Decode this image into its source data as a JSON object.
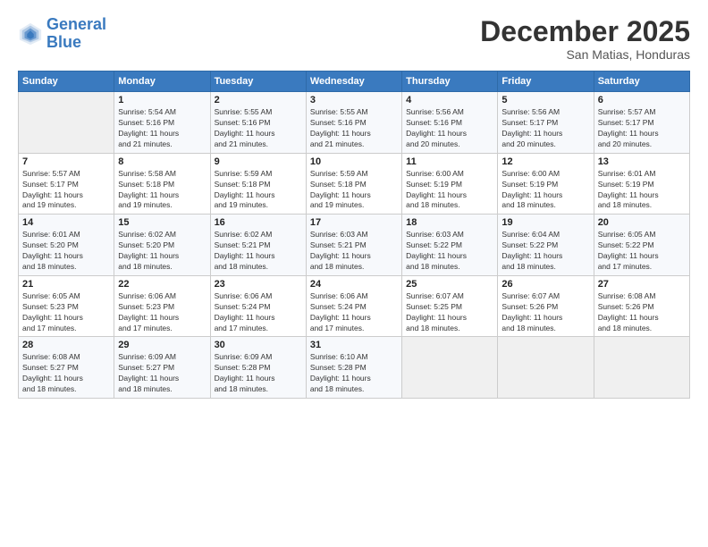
{
  "header": {
    "logo_line1": "General",
    "logo_line2": "Blue",
    "month": "December 2025",
    "location": "San Matias, Honduras"
  },
  "weekdays": [
    "Sunday",
    "Monday",
    "Tuesday",
    "Wednesday",
    "Thursday",
    "Friday",
    "Saturday"
  ],
  "weeks": [
    [
      {
        "day": "",
        "info": ""
      },
      {
        "day": "1",
        "info": "Sunrise: 5:54 AM\nSunset: 5:16 PM\nDaylight: 11 hours\nand 21 minutes."
      },
      {
        "day": "2",
        "info": "Sunrise: 5:55 AM\nSunset: 5:16 PM\nDaylight: 11 hours\nand 21 minutes."
      },
      {
        "day": "3",
        "info": "Sunrise: 5:55 AM\nSunset: 5:16 PM\nDaylight: 11 hours\nand 21 minutes."
      },
      {
        "day": "4",
        "info": "Sunrise: 5:56 AM\nSunset: 5:16 PM\nDaylight: 11 hours\nand 20 minutes."
      },
      {
        "day": "5",
        "info": "Sunrise: 5:56 AM\nSunset: 5:17 PM\nDaylight: 11 hours\nand 20 minutes."
      },
      {
        "day": "6",
        "info": "Sunrise: 5:57 AM\nSunset: 5:17 PM\nDaylight: 11 hours\nand 20 minutes."
      }
    ],
    [
      {
        "day": "7",
        "info": "Sunrise: 5:57 AM\nSunset: 5:17 PM\nDaylight: 11 hours\nand 19 minutes."
      },
      {
        "day": "8",
        "info": "Sunrise: 5:58 AM\nSunset: 5:18 PM\nDaylight: 11 hours\nand 19 minutes."
      },
      {
        "day": "9",
        "info": "Sunrise: 5:59 AM\nSunset: 5:18 PM\nDaylight: 11 hours\nand 19 minutes."
      },
      {
        "day": "10",
        "info": "Sunrise: 5:59 AM\nSunset: 5:18 PM\nDaylight: 11 hours\nand 19 minutes."
      },
      {
        "day": "11",
        "info": "Sunrise: 6:00 AM\nSunset: 5:19 PM\nDaylight: 11 hours\nand 18 minutes."
      },
      {
        "day": "12",
        "info": "Sunrise: 6:00 AM\nSunset: 5:19 PM\nDaylight: 11 hours\nand 18 minutes."
      },
      {
        "day": "13",
        "info": "Sunrise: 6:01 AM\nSunset: 5:19 PM\nDaylight: 11 hours\nand 18 minutes."
      }
    ],
    [
      {
        "day": "14",
        "info": "Sunrise: 6:01 AM\nSunset: 5:20 PM\nDaylight: 11 hours\nand 18 minutes."
      },
      {
        "day": "15",
        "info": "Sunrise: 6:02 AM\nSunset: 5:20 PM\nDaylight: 11 hours\nand 18 minutes."
      },
      {
        "day": "16",
        "info": "Sunrise: 6:02 AM\nSunset: 5:21 PM\nDaylight: 11 hours\nand 18 minutes."
      },
      {
        "day": "17",
        "info": "Sunrise: 6:03 AM\nSunset: 5:21 PM\nDaylight: 11 hours\nand 18 minutes."
      },
      {
        "day": "18",
        "info": "Sunrise: 6:03 AM\nSunset: 5:22 PM\nDaylight: 11 hours\nand 18 minutes."
      },
      {
        "day": "19",
        "info": "Sunrise: 6:04 AM\nSunset: 5:22 PM\nDaylight: 11 hours\nand 18 minutes."
      },
      {
        "day": "20",
        "info": "Sunrise: 6:05 AM\nSunset: 5:22 PM\nDaylight: 11 hours\nand 17 minutes."
      }
    ],
    [
      {
        "day": "21",
        "info": "Sunrise: 6:05 AM\nSunset: 5:23 PM\nDaylight: 11 hours\nand 17 minutes."
      },
      {
        "day": "22",
        "info": "Sunrise: 6:06 AM\nSunset: 5:23 PM\nDaylight: 11 hours\nand 17 minutes."
      },
      {
        "day": "23",
        "info": "Sunrise: 6:06 AM\nSunset: 5:24 PM\nDaylight: 11 hours\nand 17 minutes."
      },
      {
        "day": "24",
        "info": "Sunrise: 6:06 AM\nSunset: 5:24 PM\nDaylight: 11 hours\nand 17 minutes."
      },
      {
        "day": "25",
        "info": "Sunrise: 6:07 AM\nSunset: 5:25 PM\nDaylight: 11 hours\nand 18 minutes."
      },
      {
        "day": "26",
        "info": "Sunrise: 6:07 AM\nSunset: 5:26 PM\nDaylight: 11 hours\nand 18 minutes."
      },
      {
        "day": "27",
        "info": "Sunrise: 6:08 AM\nSunset: 5:26 PM\nDaylight: 11 hours\nand 18 minutes."
      }
    ],
    [
      {
        "day": "28",
        "info": "Sunrise: 6:08 AM\nSunset: 5:27 PM\nDaylight: 11 hours\nand 18 minutes."
      },
      {
        "day": "29",
        "info": "Sunrise: 6:09 AM\nSunset: 5:27 PM\nDaylight: 11 hours\nand 18 minutes."
      },
      {
        "day": "30",
        "info": "Sunrise: 6:09 AM\nSunset: 5:28 PM\nDaylight: 11 hours\nand 18 minutes."
      },
      {
        "day": "31",
        "info": "Sunrise: 6:10 AM\nSunset: 5:28 PM\nDaylight: 11 hours\nand 18 minutes."
      },
      {
        "day": "",
        "info": ""
      },
      {
        "day": "",
        "info": ""
      },
      {
        "day": "",
        "info": ""
      }
    ]
  ]
}
